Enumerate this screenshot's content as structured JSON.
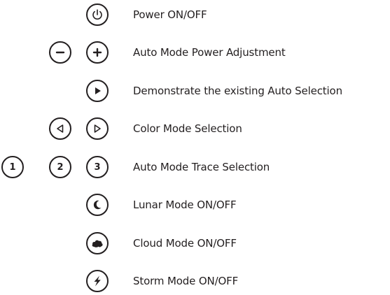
{
  "rows": [
    {
      "id": "power",
      "label": "Power ON/OFF",
      "buttons": [
        "power-icon"
      ]
    },
    {
      "id": "auto-power",
      "label": "Auto Mode Power Adjustment",
      "buttons": [
        "minus-icon",
        "plus-icon"
      ]
    },
    {
      "id": "auto-demo",
      "label": "Demonstrate the existing Auto Selection",
      "buttons": [
        "play-icon"
      ]
    },
    {
      "id": "color-mode",
      "label": "Color Mode Selection",
      "buttons": [
        "triangle-left-icon",
        "triangle-right-icon"
      ]
    },
    {
      "id": "trace",
      "label": "Auto Mode Trace Selection",
      "buttons": [
        {
          "icon": "number-1-icon",
          "text": "1"
        },
        {
          "icon": "number-2-icon",
          "text": "2"
        },
        {
          "icon": "number-3-icon",
          "text": "3"
        }
      ]
    },
    {
      "id": "lunar",
      "label": "Lunar Mode ON/OFF",
      "buttons": [
        "moon-icon"
      ]
    },
    {
      "id": "cloud",
      "label": "Cloud Mode ON/OFF",
      "buttons": [
        "cloud-icon"
      ]
    },
    {
      "id": "storm",
      "label": "Storm Mode ON/OFF",
      "buttons": [
        "lightning-icon"
      ]
    }
  ],
  "colors": {
    "ink": "#231f20",
    "background": "#ffffff"
  }
}
